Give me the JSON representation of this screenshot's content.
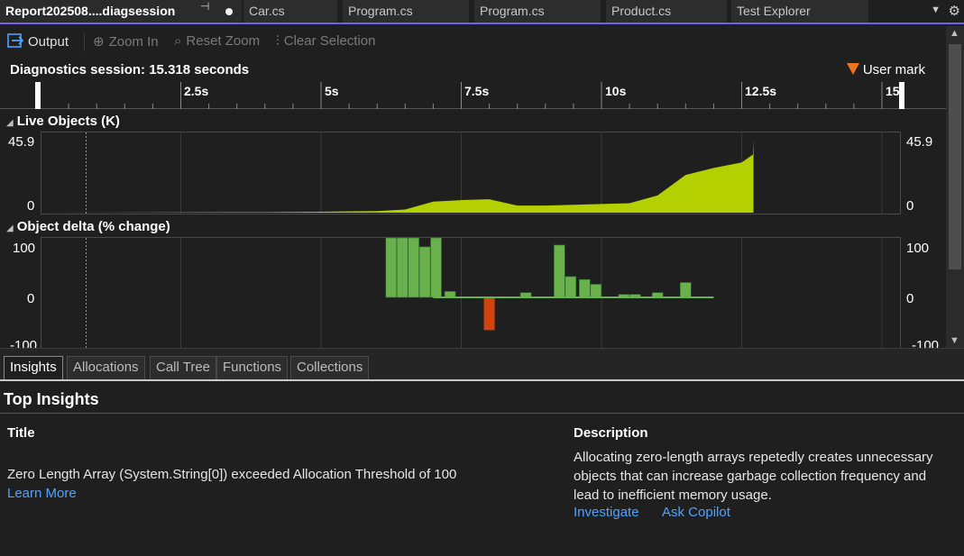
{
  "tabs": [
    {
      "label": "Report202508....diagsession",
      "active": true
    },
    {
      "label": "Car.cs"
    },
    {
      "label": "Program.cs"
    },
    {
      "label": "Program.cs"
    },
    {
      "label": "Product.cs"
    },
    {
      "label": "Test Explorer"
    }
  ],
  "toolbar": {
    "output_label": "Output",
    "zoom_in_label": "Zoom In",
    "reset_zoom_label": "Reset Zoom",
    "clear_selection_label": "Clear Selection"
  },
  "session": {
    "label": "Diagnostics session: 15.318 seconds",
    "user_mark_label": "User mark",
    "user_mark_color": "#f07320"
  },
  "ruler": {
    "ticks": [
      "2.5s",
      "5s",
      "7.5s",
      "10s",
      "12.5s",
      "15"
    ]
  },
  "live_objects": {
    "title": "Live Objects (K)",
    "y_max_label": "45.9",
    "y_min_label": "0"
  },
  "object_delta": {
    "title": "Object delta (% change)",
    "y_top_label": "100",
    "y_mid_label": "0",
    "y_bottom_label": "-100"
  },
  "chart_data": [
    {
      "type": "area",
      "title": "Live Objects (K)",
      "x_unit": "s",
      "ylim": [
        0,
        45.9
      ],
      "color": "#b4d000",
      "x": [
        0,
        4,
        5,
        6,
        6.5,
        7,
        7.5,
        8,
        8.5,
        9,
        9.5,
        10,
        10.5,
        11,
        11.5,
        12,
        12.5,
        12.7,
        12.71
      ],
      "values": [
        0,
        0.3,
        0.6,
        1,
        2,
        7,
        8,
        8.5,
        4.5,
        4.5,
        5,
        5.5,
        6,
        11,
        24,
        28.5,
        32,
        37,
        45.9
      ]
    },
    {
      "type": "bar",
      "title": "Object delta (% change)",
      "x_unit": "s",
      "ylim": [
        -100,
        100
      ],
      "positive_color": "#6ab04c",
      "negative_color": "#d2440e",
      "x": [
        6.25,
        6.45,
        6.65,
        6.85,
        7.05,
        7.3,
        8.0,
        8.65,
        9.25,
        9.45,
        9.7,
        9.9,
        10.4,
        10.6,
        11.0,
        11.5
      ],
      "values": [
        100,
        100,
        100,
        85,
        100,
        10,
        -55,
        8,
        88,
        35,
        30,
        22,
        5,
        5,
        8,
        25
      ]
    }
  ],
  "bottom_tabs": [
    "Insights",
    "Allocations",
    "Call Tree",
    "Functions",
    "Collections"
  ],
  "insights": {
    "heading": "Top Insights",
    "title_col_header": "Title",
    "description_col_header": "Description",
    "rows": [
      {
        "title": "Zero Length Array (System.String[0]) exceeded Allocation Threshold of 100",
        "learn_more": "Learn More",
        "description": "Allocating zero-length arrays repetedly creates unnecessary objects that can increase garbage collection frequency and lead to inefficient memory usage.",
        "investigate": "Investigate",
        "ask_copilot": "Ask Copilot"
      }
    ]
  }
}
